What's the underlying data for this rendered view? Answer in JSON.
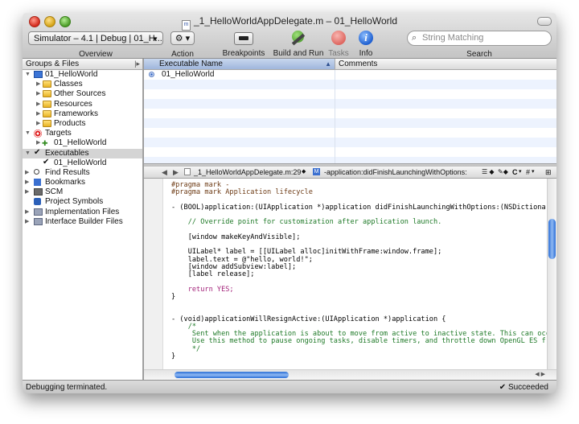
{
  "window": {
    "title": "_1_HelloWorldAppDelegate.m – 01_HelloWorld",
    "doc_icon": "m"
  },
  "toolbar": {
    "overview_popup": "Simulator – 4.1 | Debug | 01_H...",
    "overview_label": "Overview",
    "action_label": "Action",
    "breakpoints_label": "Breakpoints",
    "build_run_label": "Build and Run",
    "tasks_label": "Tasks",
    "info_label": "Info",
    "search_placeholder": "String Matching",
    "search_label": "Search"
  },
  "groups": {
    "header": "Groups & Files",
    "items": [
      {
        "label": "01_HelloWorld",
        "icon": "project-icon"
      },
      {
        "label": "Classes",
        "icon": "folder-icon"
      },
      {
        "label": "Other Sources",
        "icon": "folder-icon"
      },
      {
        "label": "Resources",
        "icon": "folder-icon"
      },
      {
        "label": "Frameworks",
        "icon": "folder-icon"
      },
      {
        "label": "Products",
        "icon": "folder-icon"
      },
      {
        "label": "Targets",
        "icon": "target-icon"
      },
      {
        "label": "01_HelloWorld",
        "icon": "app-target-icon"
      },
      {
        "label": "Executables",
        "icon": "executables-icon"
      },
      {
        "label": "01_HelloWorld",
        "icon": "executable-icon"
      },
      {
        "label": "Find Results",
        "icon": "magnifier-icon"
      },
      {
        "label": "Bookmarks",
        "icon": "bookmark-icon"
      },
      {
        "label": "SCM",
        "icon": "scm-icon"
      },
      {
        "label": "Project Symbols",
        "icon": "symbols-icon"
      },
      {
        "label": "Implementation Files",
        "icon": "smart-group-icon"
      },
      {
        "label": "Interface Builder Files",
        "icon": "smart-group-icon"
      }
    ]
  },
  "detail": {
    "col_executable": "Executable Name",
    "col_comments": "Comments",
    "rows": [
      {
        "name": "01_HelloWorld",
        "comments": ""
      }
    ]
  },
  "editor_nav": {
    "file": "_1_HelloWorldAppDelegate.m:29",
    "symbol": "-application:didFinishLaunchingWithOptions:",
    "counterparts": "C",
    "includes": "#"
  },
  "code": {
    "lines": [
      "#pragma mark -",
      "#pragma mark Application lifecycle",
      "",
      "- (BOOL)application:(UIApplication *)application didFinishLaunchingWithOptions:(NSDictionary *)launchOptions {",
      "",
      "    // Override point for customization after application launch.",
      "",
      "    [window makeKeyAndVisible];",
      "",
      "    UILabel* label = [[UILabel alloc]initWithFrame:window.frame];",
      "    label.text = @\"hello, world!\";",
      "    [window addSubview:label];",
      "    [label release];",
      "",
      "    return YES;",
      "}",
      "",
      "",
      "- (void)applicationWillResignActive:(UIApplication *)application {",
      "    /*",
      "     Sent when the application is about to move from active to inactive state. This can occur for certain",
      "     Use this method to pause ongoing tasks, disable timers, and throttle down OpenGL ES frame rates.",
      "     */",
      "}"
    ]
  },
  "status": {
    "left": "Debugging terminated.",
    "right": "Succeeded"
  }
}
